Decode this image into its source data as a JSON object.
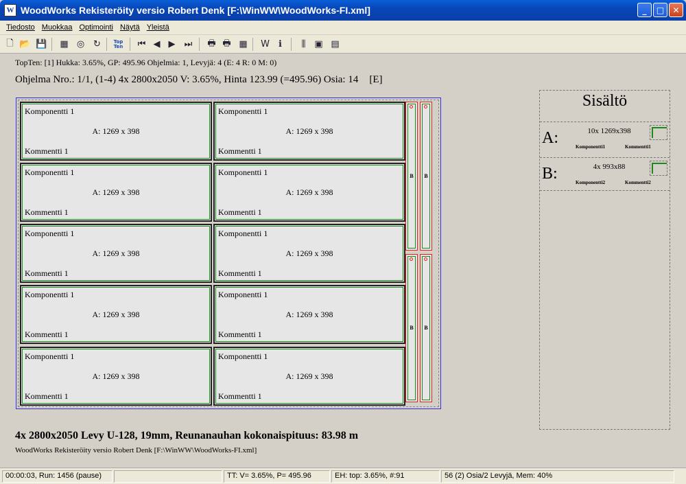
{
  "window": {
    "title": "WoodWorks Rekisteröity versio Robert Denk [F:\\WinWW\\WoodWorks-FI.xml]",
    "icon": "W"
  },
  "window_buttons": {
    "minimize": "_",
    "maximize": "□",
    "close": "✕"
  },
  "menu": [
    "Tiedosto",
    "Muokkaa",
    "Optimointi",
    "Näytä",
    "Yleistä"
  ],
  "toolbar": [
    {
      "name": "new-file-icon",
      "glyph": "🗋"
    },
    {
      "name": "open-folder-icon",
      "glyph": "📂"
    },
    {
      "name": "save-icon",
      "glyph": "💾"
    },
    {
      "name": "run-icon",
      "glyph": "▦"
    },
    {
      "name": "stop-icon",
      "glyph": "◎"
    },
    {
      "name": "refresh-icon",
      "glyph": "↻"
    },
    {
      "name": "topten-icon",
      "glyph": "Top Ten"
    },
    {
      "name": "first-icon",
      "glyph": "⏮"
    },
    {
      "name": "prev-icon",
      "glyph": "◀"
    },
    {
      "name": "next-icon",
      "glyph": "▶"
    },
    {
      "name": "last-icon",
      "glyph": "⏭"
    },
    {
      "name": "print-icon",
      "glyph": "🖶"
    },
    {
      "name": "print-preview-icon",
      "glyph": "🖶"
    },
    {
      "name": "grid-icon",
      "glyph": "▦"
    },
    {
      "name": "woodworks-icon",
      "glyph": "W"
    },
    {
      "name": "info-icon",
      "glyph": "ℹ"
    },
    {
      "name": "settings-icon",
      "glyph": "⫼"
    },
    {
      "name": "window-icon",
      "glyph": "▣"
    },
    {
      "name": "layout-icon",
      "glyph": "▤"
    }
  ],
  "info_line": "TopTen: [1] Hukka:  3.65%, GP: 495.96 Ohjelmia: 1, Levyjä: 4 (E: 4 R: 0 M: 0)",
  "program_line": "Ohjelma Nro.: 1/1, (1-4) 4x 2800x2050 V:  3.65%, Hinta 123.99 (=495.96) Osia: 14",
  "program_flag": "[E]",
  "part": {
    "component": "Komponentti 1",
    "dimension": "A: 1269 x 398",
    "comment": "Kommentti 1"
  },
  "strip_label": "B",
  "summary": "4x 2800x2050 Levy U-128, 19mm, Reunanauhan kokonaispituus: 83.98 m",
  "subtitle": "WoodWorks Rekisteröity versio Robert Denk [F:\\WinWW\\WoodWorks-FI.xml]",
  "contents": {
    "title": "Sisältö",
    "rows": [
      {
        "letter": "A:",
        "qty": "10x 1269x398",
        "component": "Komponentti1",
        "comment": "Kommentti1"
      },
      {
        "letter": "B:",
        "qty": "4x 993x88",
        "component": "Komponentti2",
        "comment": "Kommentti2"
      }
    ]
  },
  "status": [
    "00:00:03, Run: 1456 (pause)",
    "",
    "TT: V= 3.65%, P= 495.96",
    "EH: top: 3.65%,  #:91",
    "56 (2) Osia/2 Levyjä, Mem: 40%"
  ],
  "colors": {
    "part_border": "#1a8a1a",
    "strip_border": "#e02020",
    "board_border": "#3030e0"
  }
}
